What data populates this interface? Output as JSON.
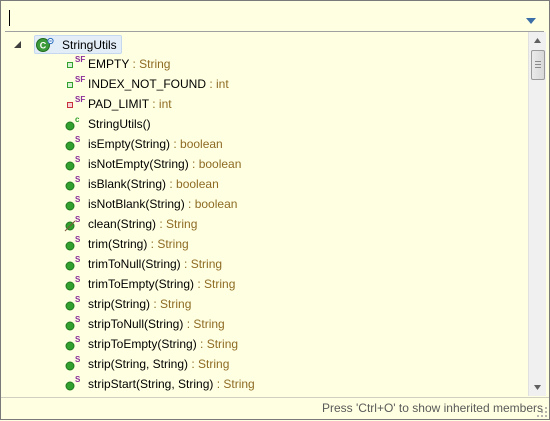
{
  "filter": {
    "value": "",
    "placeholder": "",
    "dropdown_icon": "chevron-down-icon"
  },
  "tree": {
    "root": {
      "label": "StringUtils",
      "icon": "class-icon",
      "expanded": true
    },
    "members": [
      {
        "name": "EMPTY",
        "type": " : String",
        "kind": "field-public-static-final",
        "badge": "SF"
      },
      {
        "name": "INDEX_NOT_FOUND",
        "type": " : int",
        "kind": "field-public-static-final",
        "badge": "SF"
      },
      {
        "name": "PAD_LIMIT",
        "type": " : int",
        "kind": "field-private-static-final",
        "badge": "SF"
      },
      {
        "name": "StringUtils()",
        "type": "",
        "kind": "constructor-public",
        "badge": "c"
      },
      {
        "name": "isEmpty(String)",
        "type": " : boolean",
        "kind": "method-public-static",
        "badge": "S"
      },
      {
        "name": "isNotEmpty(String)",
        "type": " : boolean",
        "kind": "method-public-static",
        "badge": "S"
      },
      {
        "name": "isBlank(String)",
        "type": " : boolean",
        "kind": "method-public-static",
        "badge": "S"
      },
      {
        "name": "isNotBlank(String)",
        "type": " : boolean",
        "kind": "method-public-static",
        "badge": "S"
      },
      {
        "name": "clean(String)",
        "type": " : String",
        "kind": "method-public-static-deprecated",
        "badge": "S"
      },
      {
        "name": "trim(String)",
        "type": " : String",
        "kind": "method-public-static",
        "badge": "S"
      },
      {
        "name": "trimToNull(String)",
        "type": " : String",
        "kind": "method-public-static",
        "badge": "S"
      },
      {
        "name": "trimToEmpty(String)",
        "type": " : String",
        "kind": "method-public-static",
        "badge": "S"
      },
      {
        "name": "strip(String)",
        "type": " : String",
        "kind": "method-public-static",
        "badge": "S"
      },
      {
        "name": "stripToNull(String)",
        "type": " : String",
        "kind": "method-public-static",
        "badge": "S"
      },
      {
        "name": "stripToEmpty(String)",
        "type": " : String",
        "kind": "method-public-static",
        "badge": "S"
      },
      {
        "name": "strip(String, String)",
        "type": " : String",
        "kind": "method-public-static",
        "badge": "S"
      },
      {
        "name": "stripStart(String, String)",
        "type": " : String",
        "kind": "method-public-static",
        "badge": "S"
      }
    ]
  },
  "status": {
    "text": "Press 'Ctrl+O' to show inherited members"
  },
  "colors": {
    "background": "#ffffe1",
    "type_text": "#8e6b24",
    "public_green": "#31a02f",
    "private_red": "#c8323c",
    "badge_purple": "#8b2d9a",
    "selection": "#e3edf8"
  }
}
